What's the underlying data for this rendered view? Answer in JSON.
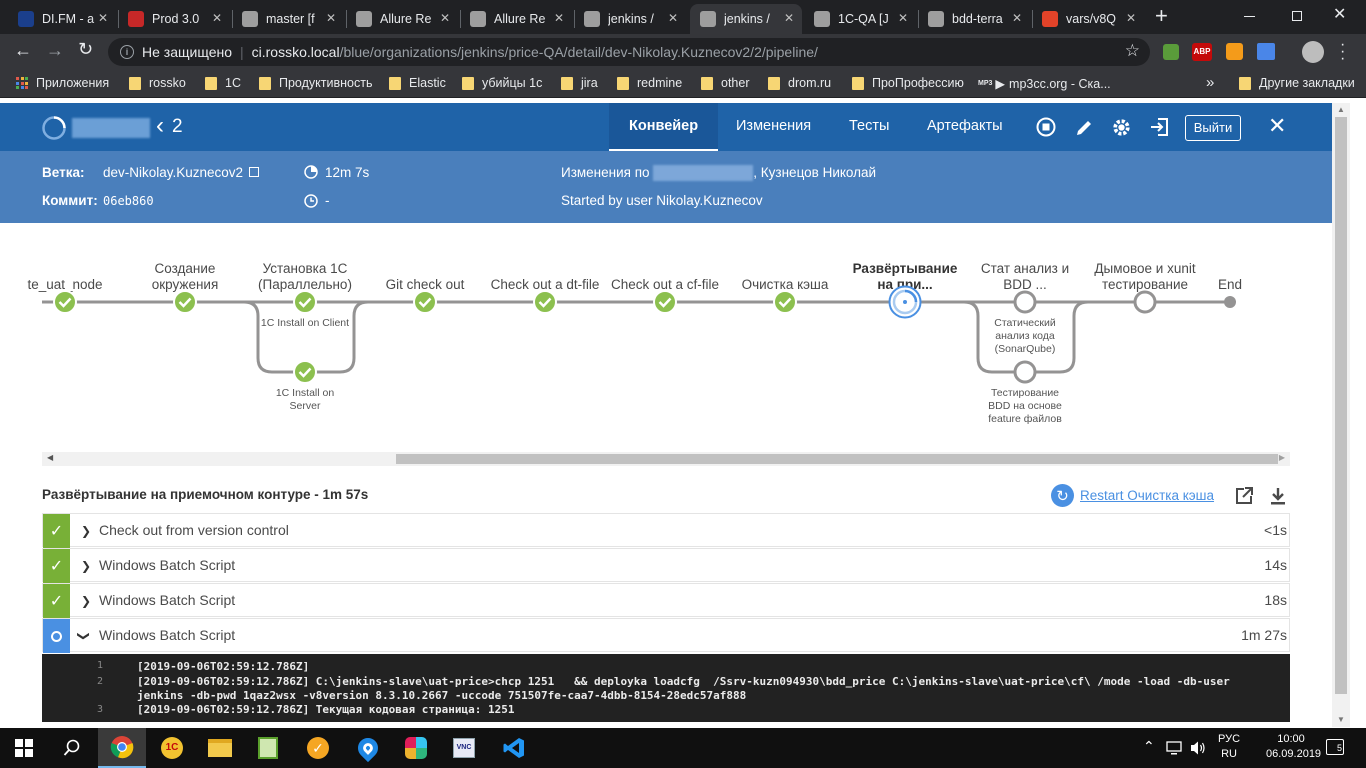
{
  "browser": {
    "tabs": [
      {
        "title": "DI.FM - a",
        "fav": "#1b3f8c"
      },
      {
        "title": "Prod 3.0",
        "fav": "#c62828"
      },
      {
        "title": "master [f",
        "fav": "#9e9e9e"
      },
      {
        "title": "Allure Re",
        "fav": "#9e9e9e"
      },
      {
        "title": "Allure Re",
        "fav": "#9e9e9e"
      },
      {
        "title": "jenkins /",
        "fav": "#9e9e9e"
      },
      {
        "title": "jenkins /",
        "fav": "#9e9e9e",
        "active": true
      },
      {
        "title": "1C-QA [J",
        "fav": "#9e9e9e"
      },
      {
        "title": "bdd-terra",
        "fav": "#9e9e9e"
      },
      {
        "title": "vars/v8Q",
        "fav": "#e24329"
      }
    ],
    "security_label": "Не защищено",
    "url_host": "ci.rossko.local",
    "url_path": "/blue/organizations/jenkins/price-QA/detail/dev-Nikolay.Kuznecov2/2/pipeline/",
    "extensions": [
      "ABP"
    ],
    "bookmarks": [
      "Приложения",
      "rossko",
      "1C",
      "Продуктивность",
      "Elastic",
      "убийцы 1с",
      "jira",
      "redmine",
      "other",
      "drom.ru",
      "ПроПрофессию",
      "mp3cc.org - Ска..."
    ],
    "mp3_badge": "MP3",
    "other_bookmarks": "Другие закладки",
    "more_bookmarks": "»"
  },
  "header": {
    "run_number": "2",
    "back_arrow": "‹",
    "nav": [
      "Конвейер",
      "Изменения",
      "Тесты",
      "Артефакты"
    ],
    "logout": "Выйти"
  },
  "summary": {
    "branch_label": "Ветка:",
    "branch": "dev-Nikolay.Kuznecov2",
    "commit_label": "Коммит:",
    "commit": "06eb860",
    "duration": "12m 7s",
    "time_ago": "-",
    "changes_prefix": "Изменения по",
    "changes_suffix": ", Кузнецов Николай",
    "started_by": "Started by user Nikolay.Kuznecov"
  },
  "pipeline": {
    "stages": [
      {
        "label": "te_uat_node",
        "status": "success"
      },
      {
        "label": "Создание окружения",
        "status": "success"
      },
      {
        "label": "Установка 1С (Параллельно)",
        "status": "success"
      },
      {
        "label": "Git check out",
        "status": "success"
      },
      {
        "label": "Check out a dt-file",
        "status": "success"
      },
      {
        "label": "Check out a cf-file",
        "status": "success"
      },
      {
        "label": "Очистка кэша",
        "status": "success"
      },
      {
        "label": "Развёртывание на при...",
        "status": "running",
        "selected": true
      },
      {
        "label": "Стат анализ и BDD ...",
        "status": "queued"
      },
      {
        "label": "Дымовое и xunit тестирование",
        "status": "queued"
      },
      {
        "label": "End",
        "status": "end"
      }
    ],
    "parallel_install": [
      "1C Install on Client",
      "1C Install on Server"
    ],
    "parallel_analysis": [
      "Статический анализ кода (SonarQube)",
      "Тестирование BDD на основе feature файлов"
    ]
  },
  "detail": {
    "title": "Развёртывание на приемочном контуре - 1m 57s",
    "restart": "Restart Очистка кэша",
    "steps": [
      {
        "label": "Check out from version control",
        "duration": "<1s",
        "status": "success"
      },
      {
        "label": "Windows Batch Script",
        "duration": "14s",
        "status": "success"
      },
      {
        "label": "Windows Batch Script",
        "duration": "18s",
        "status": "success"
      },
      {
        "label": "Windows Batch Script",
        "duration": "1m 27s",
        "status": "running"
      }
    ],
    "log": [
      {
        "n": "1",
        "text": "[2019-09-06T02:59:12.786Z]"
      },
      {
        "n": "2",
        "text": "[2019-09-06T02:59:12.786Z] C:\\jenkins-slave\\uat-price>chcp 1251   && deployka loadcfg  /Ssrv-kuzn094930\\bdd_price C:\\jenkins-slave\\uat-price\\cf\\ /mode -load -db-user",
        "text2": "jenkins -db-pwd 1qaz2wsx -v8version 8.3.10.2667 -uccode 751507fe-caa7-4dbb-8154-28edc57af888"
      },
      {
        "n": "3",
        "text": "[2019-09-06T02:59:12.786Z] Текущая кодовая страница: 1251"
      }
    ]
  },
  "taskbar": {
    "lang": "РУС",
    "lang2": "RU",
    "time": "10:00",
    "date": "06.09.2019",
    "notifications": "5"
  }
}
